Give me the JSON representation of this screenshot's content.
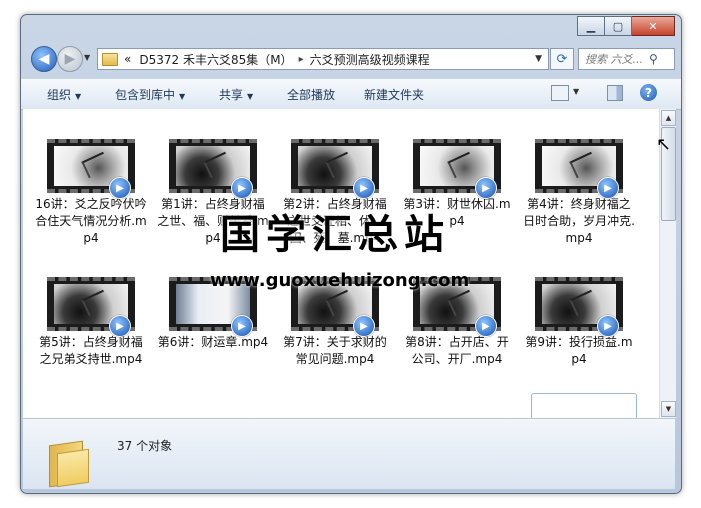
{
  "window": {
    "caption": {
      "minimize": "▁",
      "maximize": "▢",
      "close": "✕"
    }
  },
  "address": {
    "prefix": "«",
    "crumbs": [
      "D5372 禾丰六爻85集（M）",
      "六爻预测高级视频课程"
    ],
    "separator": "▸",
    "search_placeholder": "搜索 六爻..."
  },
  "toolbar": {
    "organize": "组织",
    "include_library": "包含到库中",
    "share": "共享",
    "play_all": "全部播放",
    "new_folder": "新建文件夹"
  },
  "files": [
    {
      "label": "16讲：爻之反吟伏吟合住天气情况分析.mp4",
      "style": "light"
    },
    {
      "label": "第1讲：占终身财福之世、福、财关系.mp4",
      "style": "dark"
    },
    {
      "label": "第2讲：占终身财福之世爻旺相、休、囚、死、墓.mp4",
      "style": "dark"
    },
    {
      "label": "第3讲：财世休囚.mp4",
      "style": "light"
    },
    {
      "label": "第4讲：终身财福之日时合助，岁月冲克.mp4",
      "style": "light"
    },
    {
      "label": "第5讲：占终身财福之兄弟爻持世.mp4",
      "style": "dark"
    },
    {
      "label": "第6讲：财运章.mp4",
      "style": "screen"
    },
    {
      "label": "第7讲：关于求财的常见问题.mp4",
      "style": "dark"
    },
    {
      "label": "第8讲：占开店、开公司、开厂.mp4",
      "style": "dark"
    },
    {
      "label": "第9讲：投行损益.mp4",
      "style": "dark"
    }
  ],
  "details": {
    "count_text": "37 个对象"
  },
  "watermark": {
    "text": "国学汇总站",
    "url": "www.guoxuehuizong.com"
  },
  "colors": {
    "accent": "#1d5cb3",
    "toolbar_text": "#1e395b"
  }
}
